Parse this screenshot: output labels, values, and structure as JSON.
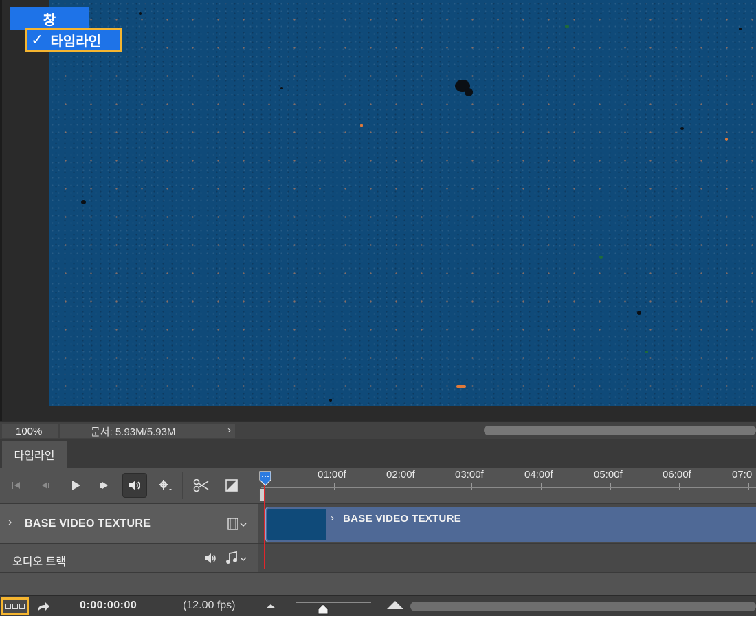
{
  "menu": {
    "title": "창",
    "item_label": "타임라인",
    "item_checked": true
  },
  "status_bar": {
    "zoom": "100%",
    "doc_info": "문서: 5.93M/5.93M",
    "more_icon": "chevron-right-icon"
  },
  "timeline_panel": {
    "tab_label": "타임라인",
    "controls": [
      {
        "name": "go-to-first-frame",
        "icon": "skip-back-icon"
      },
      {
        "name": "go-to-previous-frame",
        "icon": "step-back-icon"
      },
      {
        "name": "play",
        "icon": "play-icon"
      },
      {
        "name": "go-to-next-frame",
        "icon": "step-forward-icon"
      },
      {
        "name": "mute-audio",
        "icon": "speaker-icon",
        "active": true
      },
      {
        "name": "playback-settings",
        "icon": "gear-icon"
      },
      {
        "name": "split-at-playhead",
        "icon": "scissors-icon"
      },
      {
        "name": "transition",
        "icon": "transition-icon"
      }
    ],
    "ruler_labels": [
      "01:00f",
      "02:00f",
      "03:00f",
      "04:00f",
      "05:00f",
      "06:00f",
      "07:0"
    ],
    "video_track": {
      "name": "BASE VIDEO TEXTURE",
      "clip_label": "BASE VIDEO TEXTURE"
    },
    "audio_track": {
      "name": "오디오 트랙"
    },
    "footer": {
      "timecode": "0:00:00:00",
      "fps": "(12.00 fps)"
    }
  },
  "colors": {
    "menu_highlight": "#1e73e8",
    "callout_border": "#f5b530",
    "canvas_fill": "#0f4a79",
    "clip_fill": "#4f6996",
    "playhead": "#e0262c"
  }
}
